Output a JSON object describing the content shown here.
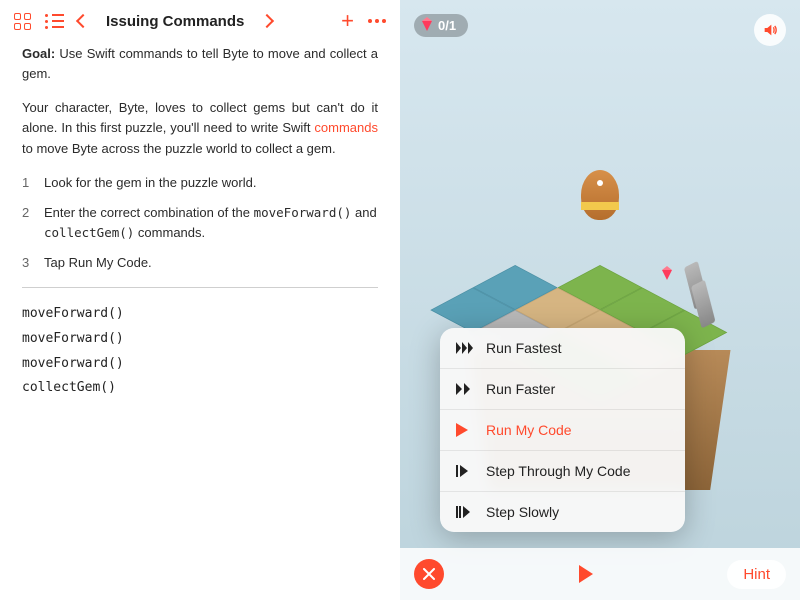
{
  "toolbar": {
    "title": "Issuing Commands"
  },
  "lesson": {
    "goal_label": "Goal:",
    "goal_text": " Use Swift commands to tell Byte to move and collect a gem.",
    "intro_a": "Your character, Byte, loves to collect gems but can't do it alone. In this first puzzle, you'll need to write Swift ",
    "intro_link": "commands",
    "intro_b": " to move Byte across the puzzle world to collect a gem.",
    "steps": {
      "s1": "Look for the gem in the puzzle world.",
      "s2a": "Enter the correct combination of the ",
      "s2code1": "moveForward()",
      "s2mid": " and ",
      "s2code2": "collectGem()",
      "s2b": " commands.",
      "s3": "Tap Run My Code."
    }
  },
  "code": {
    "l1": "moveForward()",
    "l2": "moveForward()",
    "l3": "moveForward()",
    "l4": "collectGem()"
  },
  "counter": {
    "text": "0/1"
  },
  "menu": {
    "i1": "Run Fastest",
    "i2": "Run Faster",
    "i3": "Run My Code",
    "i4": "Step Through My Code",
    "i5": "Step Slowly"
  },
  "hint": {
    "label": "Hint"
  }
}
